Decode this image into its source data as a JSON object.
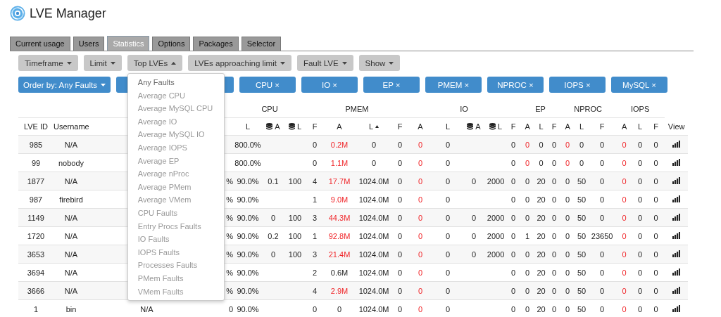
{
  "app": {
    "title": "LVE Manager"
  },
  "tabs": [
    {
      "label": "Current usage",
      "selected": false
    },
    {
      "label": "Users",
      "selected": false
    },
    {
      "label": "Statistics",
      "selected": true
    },
    {
      "label": "Options",
      "selected": false
    },
    {
      "label": "Packages",
      "selected": false
    },
    {
      "label": "Selector",
      "selected": false
    }
  ],
  "toolbar": [
    {
      "label": "Timeframe",
      "expanded": false
    },
    {
      "label": "Limit",
      "expanded": false
    },
    {
      "label": "Top LVEs",
      "expanded": true
    },
    {
      "label": "LVEs approaching limit",
      "expanded": false
    },
    {
      "label": "Fault LVE",
      "expanded": false
    },
    {
      "label": "Show",
      "expanded": false
    }
  ],
  "menu": {
    "items": [
      {
        "label": "Any Faults",
        "selected": true
      },
      {
        "label": "Average CPU",
        "selected": false
      },
      {
        "label": "Average MySQL CPU",
        "selected": false
      },
      {
        "label": "Average IO",
        "selected": false
      },
      {
        "label": "Average MySQL IO",
        "selected": false
      },
      {
        "label": "Average IOPS",
        "selected": false
      },
      {
        "label": "Average EP",
        "selected": false
      },
      {
        "label": "Average nProc",
        "selected": false
      },
      {
        "label": "Average PMem",
        "selected": false
      },
      {
        "label": "Average VMem",
        "selected": false
      },
      {
        "label": "CPU Faults",
        "selected": false
      },
      {
        "label": "Entry Procs Faults",
        "selected": false
      },
      {
        "label": "IO Faults",
        "selected": false
      },
      {
        "label": "IOPS Faults",
        "selected": false
      },
      {
        "label": "Processes Faults",
        "selected": false
      },
      {
        "label": "PMem Faults",
        "selected": false
      },
      {
        "label": "VMem Faults",
        "selected": false
      }
    ]
  },
  "chips": [
    {
      "label": "Order by: Any Faults",
      "kind": "order"
    },
    {
      "kind": "blank"
    },
    {
      "label": "CPU ×",
      "kind": "filter"
    },
    {
      "label": "IO ×",
      "kind": "filter"
    },
    {
      "label": "EP ×",
      "kind": "filter"
    },
    {
      "label": "PMEM ×",
      "kind": "filter"
    },
    {
      "label": "NPROC ×",
      "kind": "filter"
    },
    {
      "label": "IOPS ×",
      "kind": "filter"
    },
    {
      "label": "MySQL ×",
      "kind": "filter"
    }
  ],
  "table": {
    "groups": [
      "CPU",
      "PMEM",
      "IO",
      "EP",
      "NPROC",
      "IOPS"
    ],
    "columns": [
      {
        "label": "LVE ID",
        "kind": "plain"
      },
      {
        "label": "Username",
        "kind": "plain"
      },
      {
        "kind": "hidden"
      },
      {
        "kind": "hidden"
      },
      {
        "label": "L",
        "kind": "plain"
      },
      {
        "label": "A",
        "kind": "db"
      },
      {
        "label": "L",
        "kind": "db"
      },
      {
        "label": "F",
        "kind": "plain"
      },
      {
        "label": "A",
        "kind": "plain"
      },
      {
        "label": "L",
        "kind": "sorted"
      },
      {
        "label": "F",
        "kind": "plain"
      },
      {
        "label": "A",
        "kind": "plain"
      },
      {
        "label": "L",
        "kind": "plain"
      },
      {
        "label": "A",
        "kind": "db"
      },
      {
        "label": "L",
        "kind": "db"
      },
      {
        "label": "F",
        "kind": "plain"
      },
      {
        "label": "A",
        "kind": "plain"
      },
      {
        "label": "L",
        "kind": "plain"
      },
      {
        "label": "F",
        "kind": "plain"
      },
      {
        "label": "A",
        "kind": "plain"
      },
      {
        "label": "L",
        "kind": "plain"
      },
      {
        "label": "F",
        "kind": "plain"
      },
      {
        "label": "A",
        "kind": "plain"
      },
      {
        "label": "L",
        "kind": "plain"
      },
      {
        "label": "F",
        "kind": "plain"
      },
      {
        "label": "View",
        "kind": "plain"
      }
    ],
    "rows": [
      {
        "cells": [
          "985",
          "N/A",
          null,
          null,
          "800.0%",
          null,
          null,
          "0",
          {
            "text": "0.2M",
            "alert": true
          },
          "0",
          "0",
          {
            "text": "0",
            "alert": true
          },
          "0",
          null,
          null,
          "0",
          {
            "text": "0",
            "alert": true
          },
          "0",
          "0",
          {
            "text": "0",
            "alert": true
          },
          "0",
          "0",
          {
            "text": "0",
            "alert": true
          },
          "0",
          "0"
        ]
      },
      {
        "cells": [
          "99",
          "nobody",
          null,
          null,
          "800.0%",
          null,
          null,
          "0",
          {
            "text": "1.1M",
            "alert": true
          },
          "0",
          "0",
          {
            "text": "0",
            "alert": true
          },
          "0",
          null,
          null,
          "0",
          {
            "text": "0",
            "alert": true
          },
          "0",
          "0",
          {
            "text": "0",
            "alert": true
          },
          "0",
          "0",
          {
            "text": "0",
            "alert": true
          },
          "0",
          "0"
        ]
      },
      {
        "cells": [
          "1877",
          "N/A",
          null,
          "%",
          "90.0%",
          "0.1",
          "100",
          "4",
          {
            "text": "17.7M",
            "alert": true
          },
          "1024.0M",
          "0",
          {
            "text": "0",
            "alert": true
          },
          "0",
          "0",
          "2000",
          "0",
          "0",
          "20",
          "0",
          "0",
          "50",
          "0",
          {
            "text": "0",
            "alert": true
          },
          "0",
          "0"
        ]
      },
      {
        "cells": [
          "987",
          "firebird",
          null,
          "%",
          "90.0%",
          null,
          null,
          "1",
          {
            "text": "9.0M",
            "alert": true
          },
          "1024.0M",
          "0",
          {
            "text": "0",
            "alert": true
          },
          "0",
          null,
          null,
          "0",
          "0",
          "20",
          "0",
          "0",
          "50",
          "0",
          {
            "text": "0",
            "alert": true
          },
          "0",
          "0"
        ]
      },
      {
        "cells": [
          "1149",
          "N/A",
          null,
          "%",
          "90.0%",
          "0",
          "100",
          "3",
          {
            "text": "44.3M",
            "alert": true
          },
          "1024.0M",
          "0",
          {
            "text": "0",
            "alert": true
          },
          "0",
          "0",
          "2000",
          "0",
          "0",
          "20",
          "0",
          "0",
          "50",
          "0",
          {
            "text": "0",
            "alert": true
          },
          "0",
          "0"
        ]
      },
      {
        "cells": [
          "1720",
          "N/A",
          null,
          "%",
          "90.0%",
          "0.2",
          "100",
          "1",
          {
            "text": "92.8M",
            "alert": true
          },
          "1024.0M",
          "0",
          {
            "text": "0",
            "alert": true
          },
          "0",
          "0",
          "2000",
          "0",
          "1",
          "20",
          "0",
          "0",
          "50",
          "23650",
          {
            "text": "0",
            "alert": true
          },
          "0",
          "0"
        ]
      },
      {
        "cells": [
          "3653",
          "N/A",
          null,
          "%",
          "90.0%",
          "0",
          "100",
          "3",
          {
            "text": "21.4M",
            "alert": true
          },
          "1024.0M",
          "0",
          {
            "text": "0",
            "alert": true
          },
          "0",
          "0",
          "2000",
          "0",
          "0",
          "20",
          "0",
          "0",
          "50",
          "0",
          {
            "text": "0",
            "alert": true
          },
          "0",
          "0"
        ]
      },
      {
        "cells": [
          "3694",
          "N/A",
          null,
          "%",
          "90.0%",
          null,
          null,
          "2",
          "0.6M",
          "1024.0M",
          "0",
          {
            "text": "0",
            "alert": true
          },
          "0",
          null,
          null,
          "0",
          "0",
          "20",
          "0",
          "0",
          "50",
          "0",
          {
            "text": "0",
            "alert": true
          },
          "0",
          "0"
        ]
      },
      {
        "cells": [
          "3666",
          "N/A",
          null,
          "%",
          "90.0%",
          null,
          null,
          "4",
          {
            "text": "2.9M",
            "alert": true
          },
          "1024.0M",
          "0",
          {
            "text": "0",
            "alert": true
          },
          "0",
          null,
          null,
          "0",
          "0",
          "20",
          "0",
          "0",
          "50",
          "0",
          {
            "text": "0",
            "alert": true
          },
          "0",
          "0"
        ]
      },
      {
        "cells": [
          "1",
          "bin",
          "N/A",
          "0",
          "90.0%",
          null,
          null,
          "0",
          "0",
          "1024.0M",
          "0",
          {
            "text": "0",
            "alert": true
          },
          "0",
          null,
          null,
          "0",
          "0",
          "20",
          "0",
          "0",
          "50",
          "0",
          {
            "text": "0",
            "alert": true
          },
          "0",
          "0"
        ]
      }
    ]
  }
}
